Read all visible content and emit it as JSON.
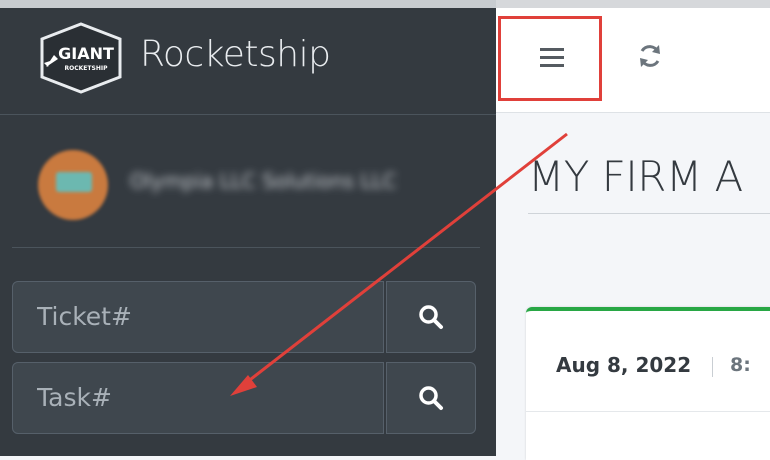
{
  "sidebar": {
    "brand": {
      "logo_text": "GIANT",
      "logo_subtext": "ROCKETSHIP",
      "name": "Rocketship"
    },
    "user": {
      "name": "Olympia LLC Solutions LLC"
    },
    "ticket_search": {
      "placeholder": "Ticket#",
      "button_icon": "search-icon"
    },
    "task_search": {
      "placeholder": "Task#",
      "button_icon": "search-icon"
    }
  },
  "navbar": {
    "menu_icon": "hamburger-menu-icon",
    "refresh_icon": "refresh-icon"
  },
  "main": {
    "page_title": "MY FIRM A",
    "card": {
      "date": "Aug 8, 2022",
      "time": "8:"
    },
    "accent_color": "#28a745"
  },
  "annotation": {
    "color": "#e0403a"
  }
}
